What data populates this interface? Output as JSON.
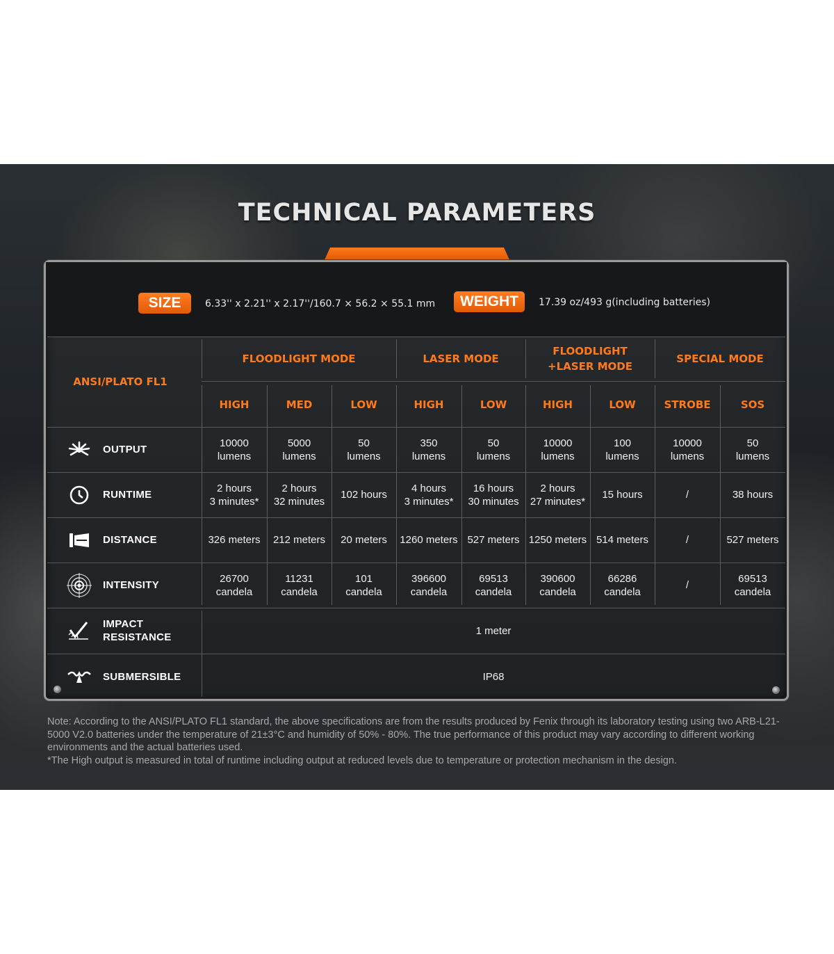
{
  "title": "TECHNICAL PARAMETERS",
  "size": {
    "label": "SIZE",
    "value": "6.33'' x 2.21'' x 2.17''/160.7 × 56.2 × 55.1 mm"
  },
  "weight": {
    "label": "WEIGHT",
    "value": "17.39 oz/493 g(including batteries)"
  },
  "table": {
    "standard_label": "ANSI/PLATO FL1",
    "mode_groups": [
      {
        "label": "FLOODLIGHT MODE"
      },
      {
        "label": "LASER MODE"
      },
      {
        "label_line1": "FLOODLIGHT",
        "label_line2": "+LASER MODE"
      },
      {
        "label": "SPECIAL MODE"
      }
    ],
    "levels": [
      "HIGH",
      "MED",
      "LOW",
      "HIGH",
      "LOW",
      "HIGH",
      "LOW",
      "STROBE",
      "SOS"
    ],
    "rows": [
      {
        "label": "OUTPUT",
        "icon": "burst-icon",
        "cells": [
          [
            "10000",
            "lumens"
          ],
          [
            "5000",
            "lumens"
          ],
          [
            "50",
            "lumens"
          ],
          [
            "350",
            "lumens"
          ],
          [
            "50",
            "lumens"
          ],
          [
            "10000",
            "lumens"
          ],
          [
            "100",
            "lumens"
          ],
          [
            "10000",
            "lumens"
          ],
          [
            "50",
            "lumens"
          ]
        ]
      },
      {
        "label": "RUNTIME",
        "icon": "clock-icon",
        "cells": [
          [
            "2 hours",
            "3 minutes*"
          ],
          [
            "2 hours",
            "32 minutes"
          ],
          [
            "102 hours"
          ],
          [
            "4 hours",
            "3 minutes*"
          ],
          [
            "16 hours",
            "30 minutes"
          ],
          [
            "2 hours",
            "27 minutes*"
          ],
          [
            "15 hours"
          ],
          [
            "/"
          ],
          [
            "38 hours"
          ]
        ]
      },
      {
        "label": "DISTANCE",
        "icon": "beam-distance-icon",
        "cells": [
          [
            "326 meters"
          ],
          [
            "212 meters"
          ],
          [
            "20 meters"
          ],
          [
            "1260 meters"
          ],
          [
            "527 meters"
          ],
          [
            "1250 meters"
          ],
          [
            "514 meters"
          ],
          [
            "/"
          ],
          [
            "527 meters"
          ]
        ]
      },
      {
        "label": "INTENSITY",
        "icon": "target-icon",
        "cells": [
          [
            "26700",
            "candela"
          ],
          [
            "11231",
            "candela"
          ],
          [
            "101",
            "candela"
          ],
          [
            "396600",
            "candela"
          ],
          [
            "69513",
            "candela"
          ],
          [
            "390600",
            "candela"
          ],
          [
            "66286",
            "candela"
          ],
          [
            "/"
          ],
          [
            "69513",
            "candela"
          ]
        ]
      }
    ],
    "impact": {
      "label_line1": "IMPACT",
      "label_line2": "RESISTANCE",
      "icon": "impact-check-icon",
      "value": "1 meter"
    },
    "submersible": {
      "label": "SUBMERSIBLE",
      "icon": "water-splash-icon",
      "value": "IP68"
    }
  },
  "notes": [
    "Note: According to the ANSI/PLATO FL1 standard, the above specifications are from the results produced by Fenix through its laboratory testing using two ARB-L21-5000 V2.0 batteries under the temperature of 21±3°C and humidity of 50% - 80%. The true performance of this product may vary according to different working environments and the actual batteries used.",
    "*The High output is measured in total of runtime including output at reduced levels due to temperature or protection mechanism in the design."
  ],
  "colors": {
    "accent": "#ff7a1a",
    "panel": "#1f2225",
    "text": "#f0f0f0"
  }
}
